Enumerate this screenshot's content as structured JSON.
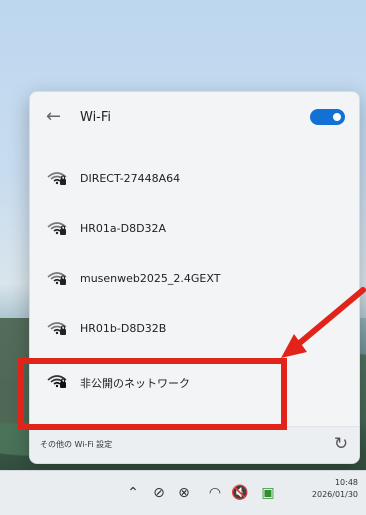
{
  "panel": {
    "back_label": "←",
    "title": "Wi-Fi",
    "toggle_state": "on",
    "networks": [
      {
        "name": "DIRECT-27448A64"
      },
      {
        "name": "HR01a-D8D32A"
      },
      {
        "name": "musenweb2025_2.4GEXT"
      },
      {
        "name": "HR01b-D8D32B"
      },
      {
        "name": "非公開のネットワーク"
      }
    ],
    "footer_link": "その他の Wi-Fi 設定"
  },
  "taskbar": {
    "time": "10:48",
    "date": "2026/01/30"
  },
  "colors": {
    "accent": "#1371d6",
    "annotation": "#e2231a"
  },
  "icons": {
    "back": "back-arrow-icon",
    "wifi_locked": "wifi-locked-icon",
    "refresh": "refresh-icon",
    "chevron": "chevron-up-icon"
  }
}
